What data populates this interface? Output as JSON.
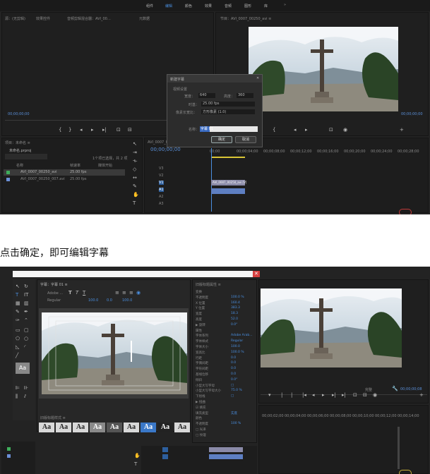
{
  "caption": "点击确定，即可编辑字幕",
  "top_app": {
    "menu": [
      "组件",
      "编辑",
      "颜色",
      "效果",
      "音频",
      "图形",
      "库"
    ],
    "menu_active_index": 1,
    "source_tabs": [
      "源：(无剪辑)",
      "效果控件",
      "音频剪辑混合器：AVI_00…",
      "元数据"
    ],
    "program_tab": "节目：AVI_0007_00250_avi  ≡",
    "timecode_left": "00;00;00;00",
    "timecode_program": "00;00;00;00",
    "project_panel_title": "项目：未命名  ≡",
    "project_file": "未命名.prproj",
    "item_count": "1个项已选择，共 2 项",
    "column_name": "名称",
    "column_fps": "帧速率",
    "column_media_start": "媒体开始",
    "project_items": [
      {
        "name": "AVI_0007_00250_avi",
        "fps": "25.00 fps",
        "color": "#3fae5b"
      },
      {
        "name": "AVI_0007_00250_007.avi",
        "fps": "25.00 fps",
        "color": "#6b8fd6"
      }
    ],
    "sequence_tab": "AVI_0007_00250_avi  ≡",
    "sequence_timecode": "00;00;00;00",
    "ruler_labels": [
      "00;00",
      "00;00;04;00",
      "00;00;08;00",
      "00;00;12;00",
      "00;00;16;00",
      "00;00;20;00",
      "00;00;24;00",
      "00;00;28;00"
    ],
    "tracks": [
      "V3",
      "V2",
      "V1",
      "A1",
      "A2",
      "A3"
    ],
    "clip_video": "AVI_0007_00250_avi [V]",
    "clip_audio": "",
    "dialog": {
      "title": "新建字幕",
      "section": "视频设置",
      "width_label": "宽度：",
      "width_value": "640",
      "height_label": "高度：",
      "height_value": "360",
      "timebase_label": "时基：",
      "timebase_value": "25.00 fps",
      "par_label": "像素长宽比：",
      "par_value": "方形像素 (1.0)",
      "name_label": "名称：",
      "name_value": "字幕 01",
      "ok": "确定",
      "cancel": "取消"
    }
  },
  "bottom_app": {
    "titler_tab": "字幕：字幕 01  ≡",
    "font_family_short": "Adobe ...",
    "font_style_short": "Regular",
    "font_size_values": [
      "100.0",
      "0.0",
      "100.0"
    ],
    "props_title": "旧版标题属性  ≡",
    "props_rows": [
      {
        "label": "变换",
        "value": ""
      },
      {
        "label": "不透明度",
        "value": "100.0 %"
      },
      {
        "label": "X 位置",
        "value": "160.4"
      },
      {
        "label": "Y 位置",
        "value": "383.3"
      },
      {
        "label": "宽度",
        "value": "18.3"
      },
      {
        "label": "高度",
        "value": "52.0"
      },
      {
        "label": "▶ 旋转",
        "value": "0.0°"
      },
      {
        "label": "属性",
        "value": ""
      },
      {
        "label": "字体系列",
        "value": "Adobe Arab..."
      },
      {
        "label": "字体样式",
        "value": "Regular"
      },
      {
        "label": "字体大小",
        "value": "100.0"
      },
      {
        "label": "宽高比",
        "value": "100.0 %"
      },
      {
        "label": "行距",
        "value": "0.0"
      },
      {
        "label": "字偶间距",
        "value": "0.0"
      },
      {
        "label": "字符间距",
        "value": "0.0"
      },
      {
        "label": "基线位移",
        "value": "0.0"
      },
      {
        "label": "倾斜",
        "value": "0.0°"
      },
      {
        "label": "小型大写字母",
        "value": "□"
      },
      {
        "label": "小型大写字母大小",
        "value": "75.0 %"
      },
      {
        "label": "下划线",
        "value": "□"
      },
      {
        "label": "▶ 扭曲",
        "value": ""
      },
      {
        "label": "☑ 填充",
        "value": ""
      },
      {
        "label": "填充类型",
        "value": "实底"
      },
      {
        "label": "颜色",
        "value": ""
      },
      {
        "label": "不透明度",
        "value": "100 %"
      },
      {
        "label": "□ 光泽",
        "value": ""
      },
      {
        "label": "□ 纹理",
        "value": ""
      }
    ],
    "styles_title": "旧版标题样式  ≡",
    "style_swatch_label": "Aa",
    "program_dropdown": "完整",
    "program_timecode": "00;00;00;08",
    "ruler_labels": [
      "00;00;02;00",
      "00;00;04;00",
      "00;00;06;00",
      "00;00;08;00",
      "00;00;10;00",
      "00;00;12;00",
      "00;00;14;00"
    ]
  }
}
